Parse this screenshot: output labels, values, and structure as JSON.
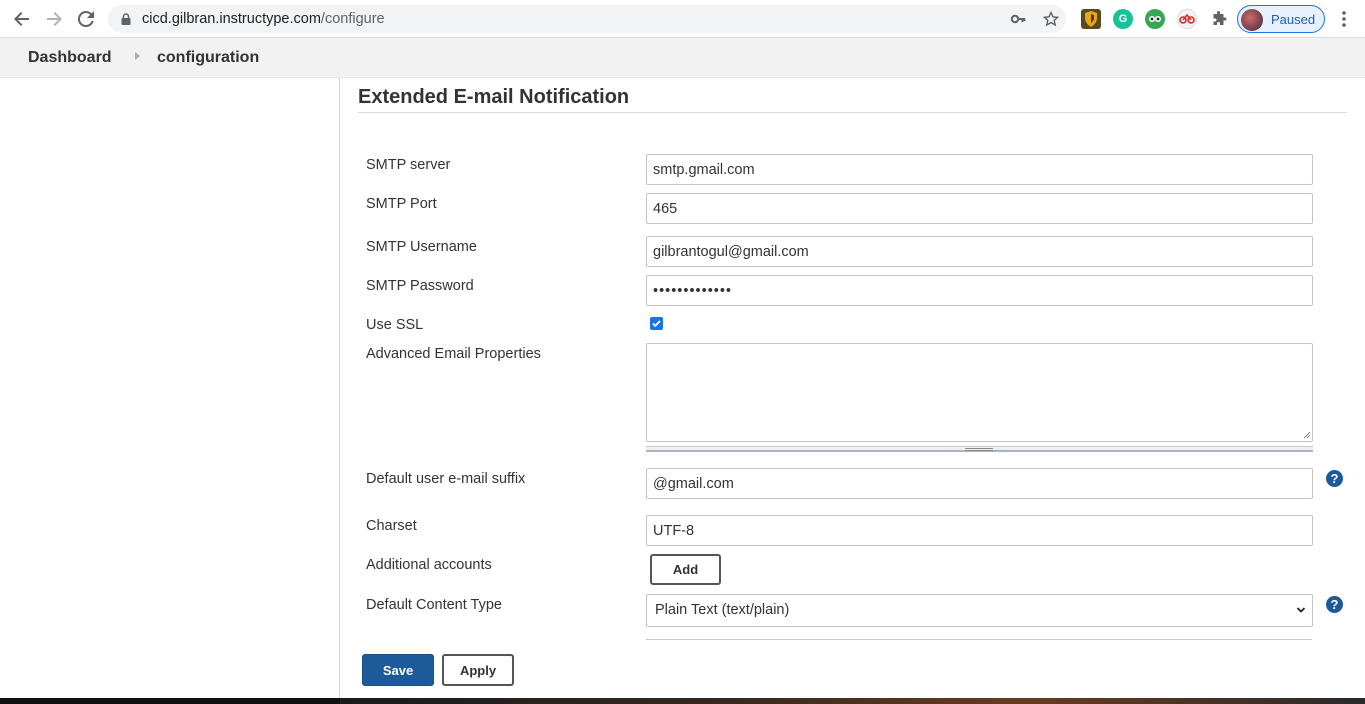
{
  "browser": {
    "url_host": "cicd.gilbran.instructype.com",
    "url_path": "/configure",
    "profile_label": "Paused"
  },
  "breadcrumb": {
    "items": [
      "Dashboard",
      "configuration"
    ]
  },
  "section": {
    "title": "Extended E-mail Notification"
  },
  "form": {
    "smtp_server": {
      "label": "SMTP server",
      "value": "smtp.gmail.com"
    },
    "smtp_port": {
      "label": "SMTP Port",
      "value": "465"
    },
    "smtp_username": {
      "label": "SMTP Username",
      "value": "gilbrantogul@gmail.com"
    },
    "smtp_password": {
      "label": "SMTP Password",
      "value": "•••••••••••••"
    },
    "use_ssl": {
      "label": "Use SSL",
      "checked": true
    },
    "advanced_props": {
      "label": "Advanced Email Properties",
      "value": ""
    },
    "default_suffix": {
      "label": "Default user e-mail suffix",
      "value": "@gmail.com"
    },
    "charset": {
      "label": "Charset",
      "value": "UTF-8"
    },
    "additional_accounts": {
      "label": "Additional accounts",
      "button": "Add"
    },
    "content_type": {
      "label": "Default Content Type",
      "value": "Plain Text (text/plain)"
    }
  },
  "buttons": {
    "save": "Save",
    "apply": "Apply"
  },
  "colors": {
    "primary_button": "#1d5a99",
    "checkbox": "#1a73e8",
    "breadcrumb_bg": "#f2f2f2"
  }
}
